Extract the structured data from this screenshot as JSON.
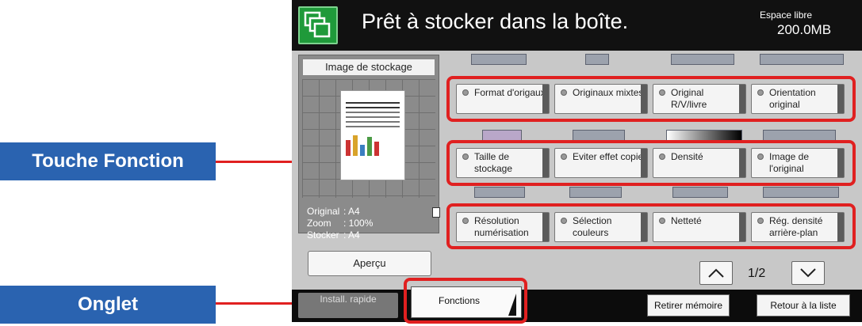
{
  "header": {
    "title": "Prêt à stocker dans la boîte.",
    "free_space_label": "Espace libre",
    "free_space_value": "200.0MB"
  },
  "preview": {
    "title": "Image de stockage",
    "original_label": "Original",
    "original_value": ": A4",
    "zoom_label": "Zoom",
    "zoom_value": ": 100%",
    "stocker_label": "Stocker",
    "stocker_value": ": A4",
    "preview_button": "Aperçu"
  },
  "functions": {
    "row1": [
      "Format d'origaux",
      "Originaux mixtes",
      "Original R/V/livre",
      "Orientation original"
    ],
    "row2": [
      "Taille de stockage",
      "Eviter effet copie",
      "Densité",
      "Image de l'original"
    ],
    "row3": [
      "Résolution numérisation",
      "Sélection couleurs",
      "Netteté",
      "Rég. densité arrière-plan"
    ]
  },
  "pagination": {
    "indicator": "1/2",
    "up": "^",
    "down": "v"
  },
  "footer": {
    "setup_tab": "Install. rapide",
    "functions_tab": "Fonctions",
    "remove_memory": "Retirer mémoire",
    "back_to_list": "Retour à la liste"
  },
  "callouts": {
    "function_key": "Touche Fonction",
    "tab": "Onglet"
  },
  "colors": {
    "callout_bg": "#2a63b0",
    "highlight": "#e02020",
    "header_icon": "#1f9a3a"
  },
  "icons": [
    "boxes-icon",
    "led-indicator-icon",
    "up-arrow-icon",
    "down-arrow-icon",
    "page-icon"
  ]
}
